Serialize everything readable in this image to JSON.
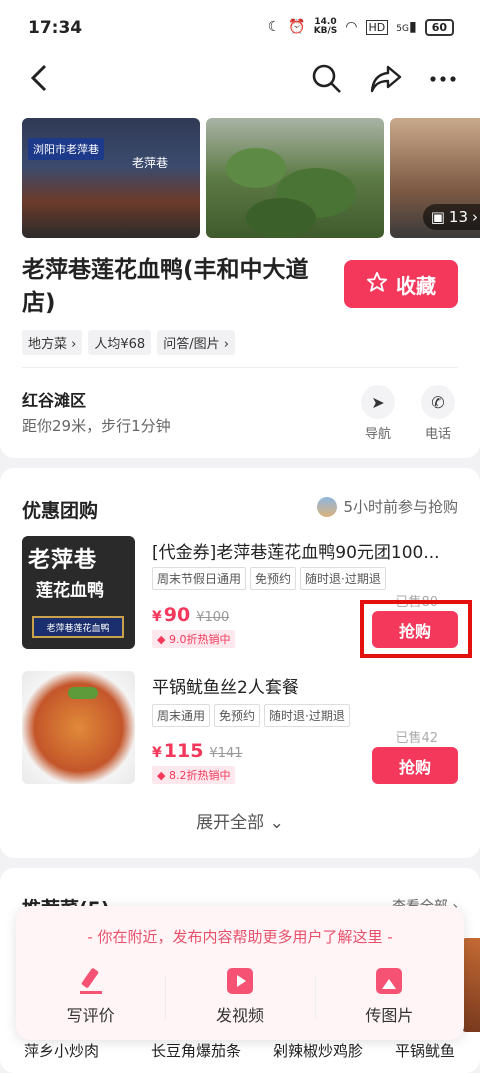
{
  "status": {
    "time": "17:34",
    "net_speed": "14.0",
    "net_unit": "KB/S",
    "hd": "HD",
    "signal": "5G",
    "battery": "60"
  },
  "photos": {
    "count": "13",
    "sign1": "浏阳市老萍巷",
    "sign2": "老萍巷"
  },
  "shop": {
    "name": "老萍巷莲花血鸭(丰和中大道店)",
    "favorite_label": "收藏",
    "tags": [
      "地方菜",
      "人均¥68",
      "问答/图片"
    ],
    "district": "红谷滩区",
    "distance": "距你29米，步行1分钟",
    "nav_label": "导航",
    "phone_label": "电话"
  },
  "deals": {
    "title": "优惠团购",
    "recent": "5小时前参与抢购",
    "items": [
      {
        "name": "[代金券]老萍巷莲花血鸭90元团100...",
        "tags": [
          "周末节假日通用",
          "免预约",
          "随时退·过期退"
        ],
        "price": "90",
        "orig": "¥100",
        "discount": "9.0折热销中",
        "sold": "已售80",
        "buy_label": "抢购",
        "img_t1": "老萍巷",
        "img_t2": "莲花血鸭",
        "img_t3": "老萍巷莲花血鸭"
      },
      {
        "name": "平锅鱿鱼丝2人套餐",
        "tags": [
          "周末通用",
          "免预约",
          "随时退·过期退"
        ],
        "price": "115",
        "orig": "¥141",
        "discount": "8.2折热销中",
        "sold": "已售42",
        "buy_label": "抢购"
      }
    ],
    "expand_label": "展开全部"
  },
  "recommend": {
    "title": "推荐菜(5)",
    "more": "查看全部",
    "dishes": [
      "萍乡小炒肉",
      "长豆角爆茄条",
      "剁辣椒炒鸡胗",
      "平锅鱿鱼"
    ]
  },
  "popup": {
    "message": "- 你在附近，发布内容帮助更多用户了解这里 -",
    "buttons": [
      "写评价",
      "发视频",
      "传图片"
    ]
  },
  "colors": {
    "accent": "#f3385b",
    "highlight": "#e41010"
  }
}
